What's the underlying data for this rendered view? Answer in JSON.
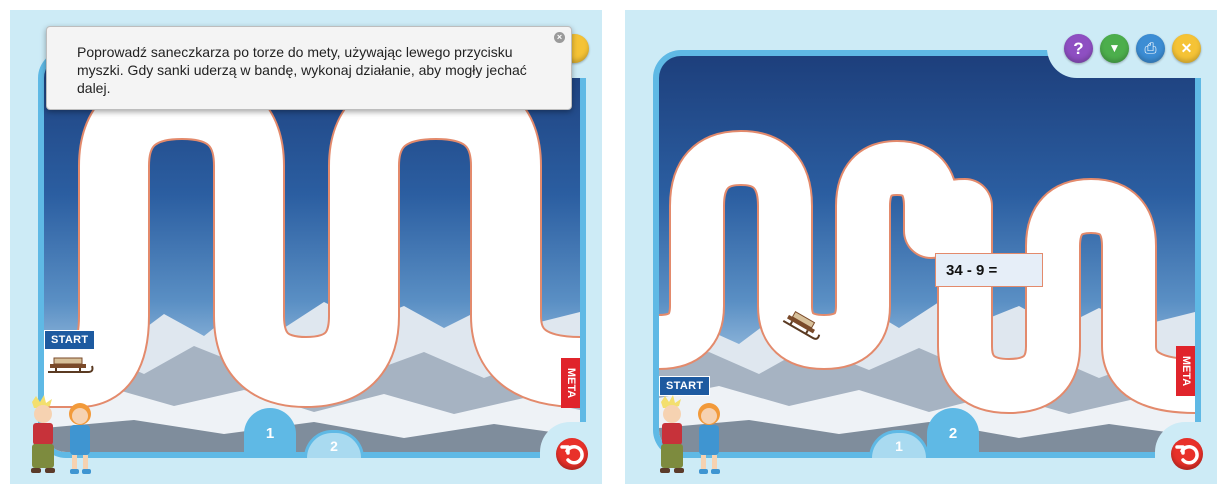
{
  "instruction": {
    "text": "Poprowadź saneczkarza po torze do mety, używając lewego przycisku myszki. Gdy sanki uderzą w bandę, wykonaj działanie, aby mogły jechać dalej.",
    "close_glyph": "×"
  },
  "track": {
    "start_label": "START",
    "finish_label": "META"
  },
  "toolbar": {
    "help_icon": "question-mark-icon",
    "next_icon": "arrow-down-icon",
    "print_icon": "printer-icon",
    "close_icon": "close-icon",
    "help_glyph": "?",
    "next_glyph": "▼",
    "print_glyph": "⎙",
    "close_glyph": "✕",
    "colors": {
      "help": "#8e4fc2",
      "next": "#4cae4c",
      "print": "#3c8dd4",
      "close": "#f5c336"
    }
  },
  "levels": {
    "tab1_label": "1",
    "tab2_label": "2",
    "left_active": "1",
    "right_active": "2"
  },
  "problem": {
    "expression": "34 - 9 ="
  },
  "return_button": {
    "icon": "return-arrow-icon",
    "color": "#e8312a"
  },
  "colors": {
    "frame": "#5fb9e5",
    "background": "#cdebf6",
    "track_edge": "#e38a6c",
    "start_badge": "#1d5aa0",
    "meta_badge": "#e0242b"
  }
}
